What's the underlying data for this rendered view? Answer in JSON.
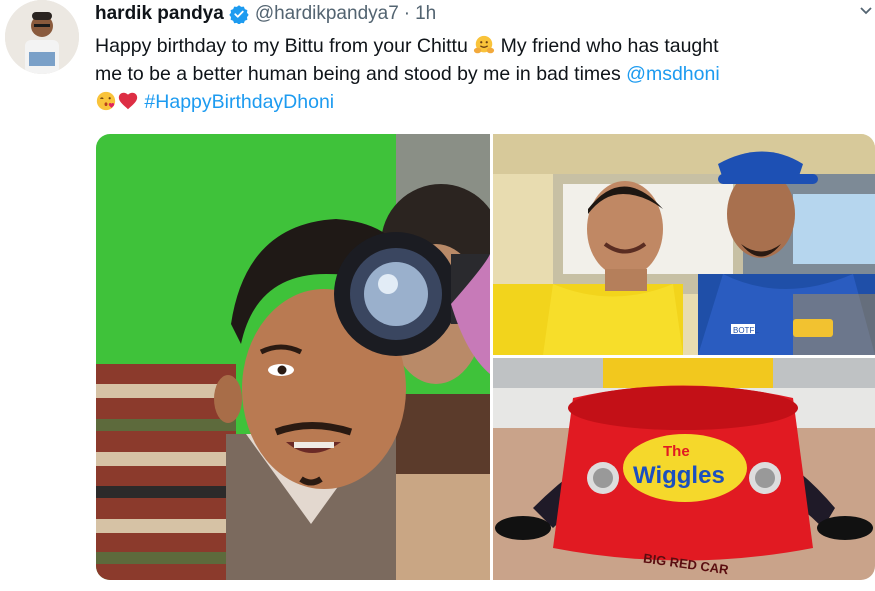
{
  "tweet": {
    "display_name": "hardik pandya",
    "handle": "@hardikpandya7",
    "separator": "·",
    "time": "1h",
    "text_line1": "Happy birthday to my Bittu from your Chittu",
    "text_line1b": "My friend who has taught",
    "text_line2": "me to be a better human being and stood by me in bad times",
    "mention": "@msdhoni",
    "hashtag": "#HappyBirthdayDhoni"
  },
  "media": {
    "wiggles_logo_line1": "The",
    "wiggles_logo_line2": "Wiggles",
    "car_plate_text": "BIG RED CAR",
    "jersey_text": "BOTFL"
  },
  "icons": {
    "verified": "verified-badge-icon",
    "hug": "hugging-face-emoji",
    "kiss": "face-blowing-kiss-emoji",
    "heart": "red-heart-emoji",
    "more": "chevron-down-icon"
  },
  "colors": {
    "link": "#1d9bf0",
    "verified": "#1d9bf0",
    "secondary_text": "#536471"
  }
}
